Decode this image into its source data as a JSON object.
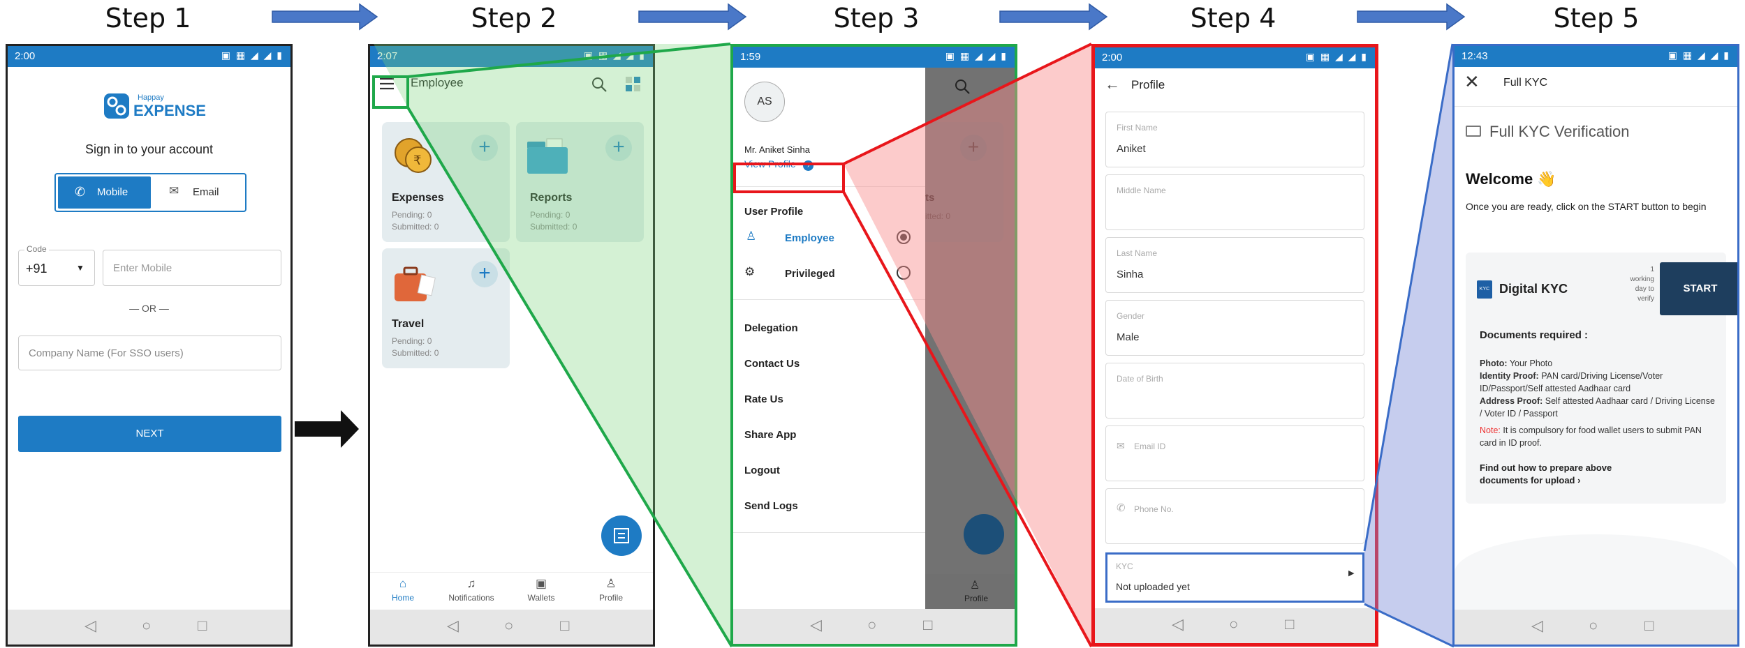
{
  "steps": [
    "Step 1",
    "Step 2",
    "Step 3",
    "Step 4",
    "Step 5"
  ],
  "colors": {
    "accent": "#1e7bc4",
    "green": "#1fa84a",
    "red": "#e8161b",
    "blue": "#3a6cc7"
  },
  "p1": {
    "time": "2:00",
    "status_icons": "▣ ▦ ◢ ◢ ▮",
    "brand_small": "Happay",
    "brand": "EXPENSE",
    "heading": "Sign in to your account",
    "tab_mobile": "Mobile",
    "tab_email": "Email",
    "code_label": "Code",
    "code_value": "+91",
    "mobile_placeholder": "Enter Mobile",
    "or": "— OR —",
    "company_placeholder": "Company Name (For SSO users)",
    "next": "NEXT"
  },
  "p2": {
    "time": "2:07",
    "status_icons": "▣ ▦ ◢ ◢ ▮",
    "title": "Employee",
    "cards": [
      {
        "title": "Expenses",
        "pending": "Pending: 0",
        "submitted": "Submitted: 0"
      },
      {
        "title": "Reports",
        "pending": "Pending: 0",
        "submitted": "Submitted: 0"
      },
      {
        "title": "Travel",
        "pending": "Pending: 0",
        "submitted": "Submitted: 0"
      }
    ],
    "nav": [
      "Home",
      "Notifications",
      "Wallets",
      "Profile"
    ]
  },
  "p3": {
    "time": "1:59",
    "status_icons": "▣ ▦ ◢ ◢ ▮",
    "initials": "AS",
    "name": "Mr. Aniket  Sinha",
    "view_profile": "View Profile",
    "section": "User Profile",
    "employee": "Employee",
    "privileged": "Privileged",
    "items": [
      "Delegation",
      "Contact Us",
      "Rate Us",
      "Share App",
      "Logout",
      "Send Logs"
    ],
    "profile_nav": "Profile",
    "behind_ts": "ts",
    "behind_sub": "itted: 0"
  },
  "p4": {
    "time": "2:00",
    "status_icons": "▣ ▦ ◢ ◢ ▮",
    "title": "Profile",
    "fields": [
      {
        "label": "First Name",
        "value": "Aniket"
      },
      {
        "label": "Middle Name",
        "value": ""
      },
      {
        "label": "Last Name",
        "value": "Sinha"
      },
      {
        "label": "Gender",
        "value": "Male"
      },
      {
        "label": "Date of Birth",
        "value": ""
      },
      {
        "label": "Email ID",
        "value": ""
      },
      {
        "label": "Phone No.",
        "value": ""
      }
    ],
    "kyc_label": "KYC",
    "kyc_value": "Not uploaded yet"
  },
  "p5": {
    "time": "12:43",
    "status_icons": "▣ ▦ ◢ ◢ ▮",
    "title": "Full KYC",
    "heading": "Full KYC Verification",
    "welcome": "Welcome 👋",
    "intro": "Once you are ready, click on the START button to begin",
    "card_title": "Digital KYC",
    "kyc_badge": "KYC",
    "eta_1": "1",
    "eta_2": "working",
    "eta_3": "day to",
    "eta_4": "verify",
    "start": "START",
    "docs_heading": "Documents required :",
    "photo_label": "Photo:",
    "photo_text": " Your Photo",
    "identity_label": "Identity Proof:",
    "identity_text": " PAN card/Driving License/Voter ID/Passport/Self attested Aadhaar card",
    "address_label": "Address Proof:",
    "address_text": " Self attested Aadhaar card / Driving License / Voter ID / Passport",
    "note_label": "Note:",
    "note_text": " It is compulsory for food wallet users to submit PAN card in ID proof.",
    "find_out": "Find out how to prepare above documents for upload ›"
  }
}
